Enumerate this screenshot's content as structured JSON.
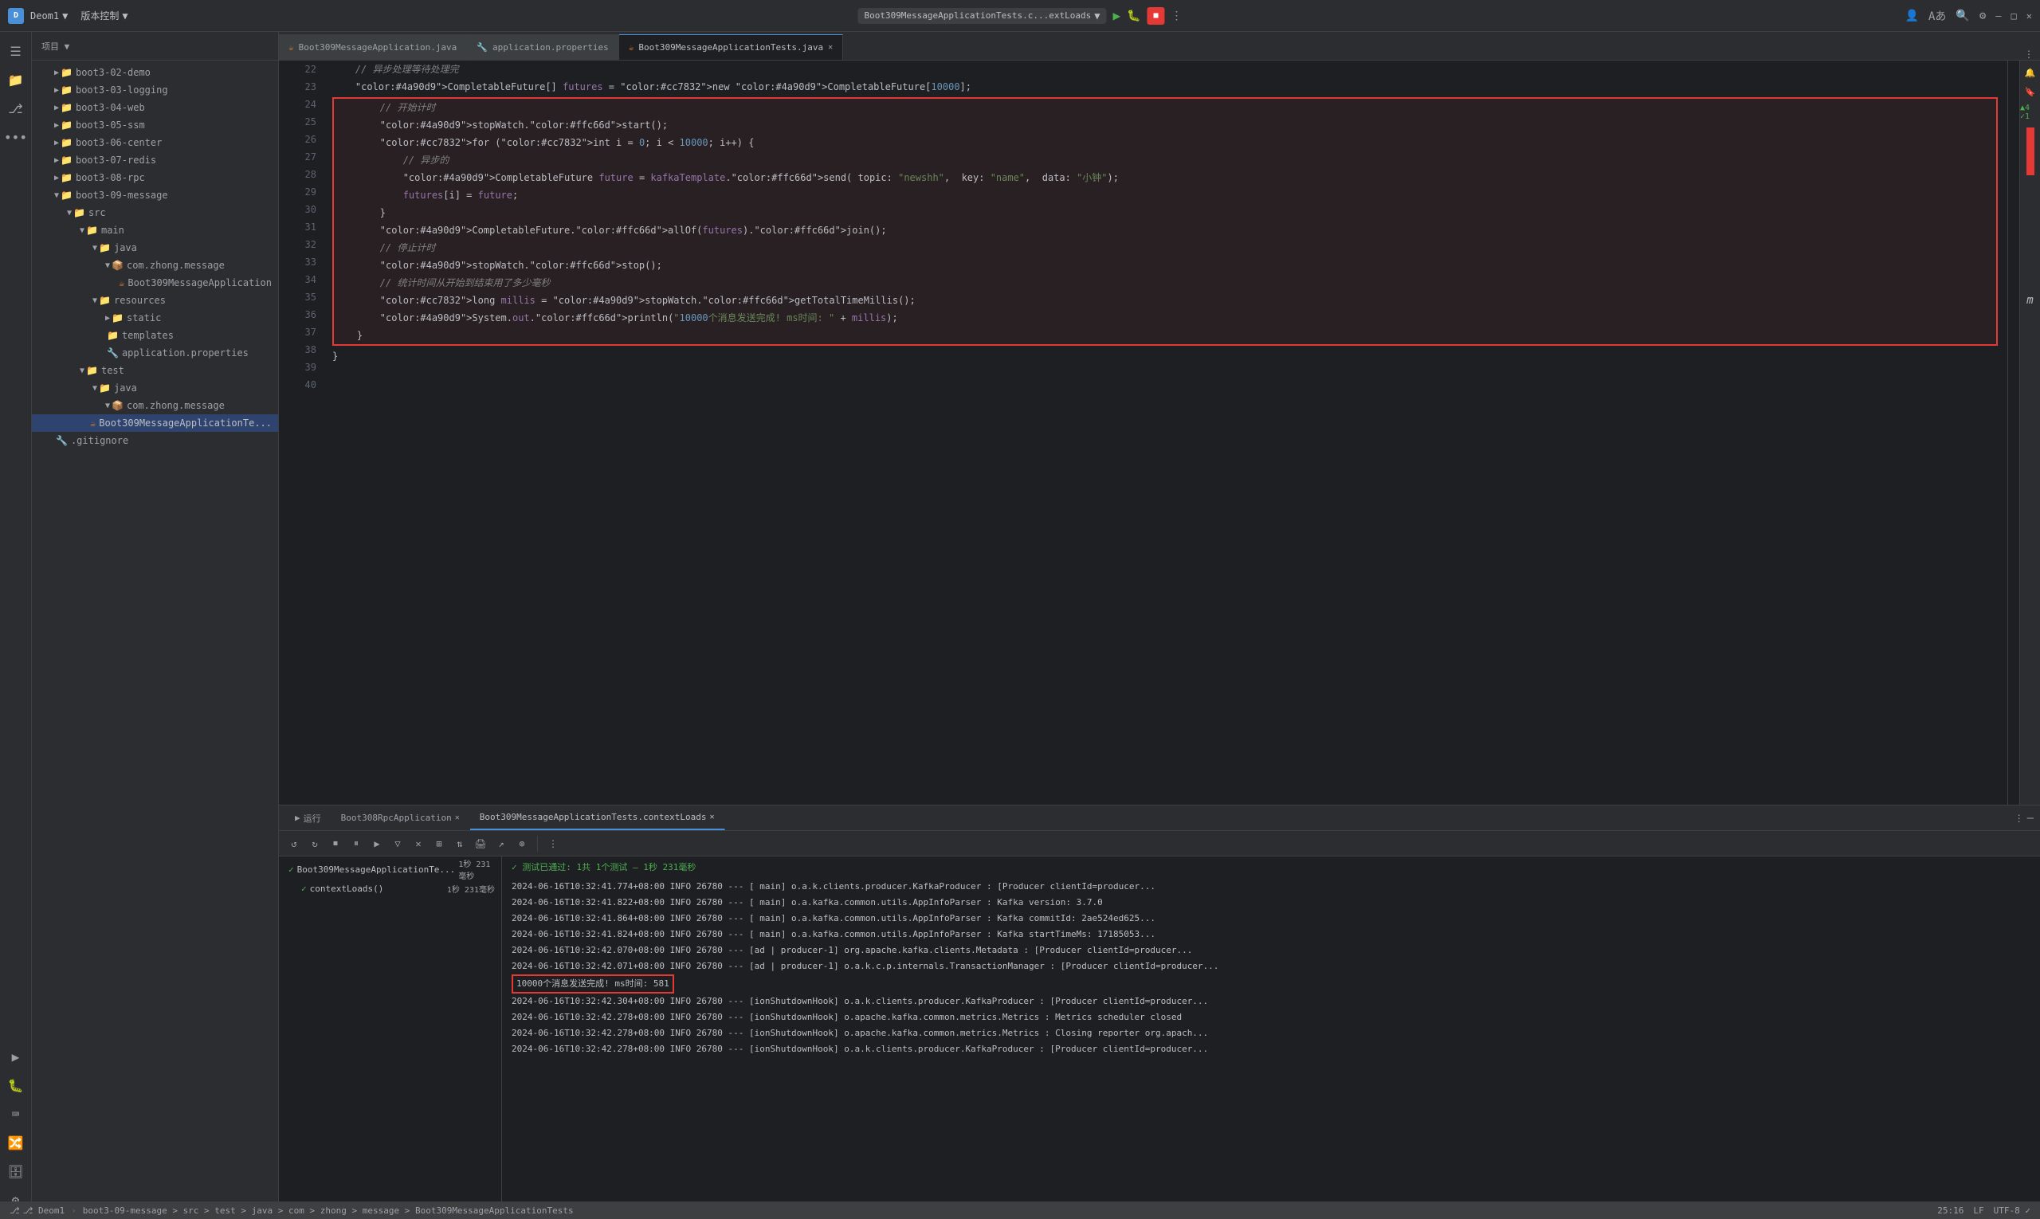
{
  "titlebar": {
    "app_icon": "D",
    "project_name": "Deom1",
    "project_arrow": "▼",
    "vcs_label": "版本控制",
    "vcs_arrow": "▼",
    "run_config": "Boot309MessageApplicationTests.c...extLoads",
    "run_config_arrow": "▼",
    "run_btn": "▶",
    "win_minimize": "—",
    "win_maximize": "□",
    "win_close": "✕"
  },
  "left_panel": {
    "header": "项目 ▼",
    "tree_items": [
      {
        "indent": 20,
        "arrow": "▶",
        "icon": "📁",
        "label": "boot3-02-demo",
        "type": "folder"
      },
      {
        "indent": 20,
        "arrow": "▶",
        "icon": "📁",
        "label": "boot3-03-logging",
        "type": "folder"
      },
      {
        "indent": 20,
        "arrow": "▶",
        "icon": "📁",
        "label": "boot3-04-web",
        "type": "folder"
      },
      {
        "indent": 20,
        "arrow": "▶",
        "icon": "📁",
        "label": "boot3-05-ssm",
        "type": "folder"
      },
      {
        "indent": 20,
        "arrow": "▶",
        "icon": "📁",
        "label": "boot3-06-center",
        "type": "folder"
      },
      {
        "indent": 20,
        "arrow": "▶",
        "icon": "📁",
        "label": "boot3-07-redis",
        "type": "folder"
      },
      {
        "indent": 20,
        "arrow": "▶",
        "icon": "📁",
        "label": "boot3-08-rpc",
        "type": "folder"
      },
      {
        "indent": 20,
        "arrow": "▼",
        "icon": "📁",
        "label": "boot3-09-message",
        "type": "folder",
        "expanded": true
      },
      {
        "indent": 36,
        "arrow": "▼",
        "icon": "📁",
        "label": "src",
        "type": "folder",
        "expanded": true
      },
      {
        "indent": 52,
        "arrow": "▼",
        "icon": "📁",
        "label": "main",
        "type": "folder",
        "expanded": true
      },
      {
        "indent": 68,
        "arrow": "▼",
        "icon": "📁",
        "label": "java",
        "type": "folder",
        "expanded": true
      },
      {
        "indent": 84,
        "arrow": "▼",
        "icon": "📦",
        "label": "com.zhong.message",
        "type": "package",
        "expanded": true
      },
      {
        "indent": 100,
        "arrow": " ",
        "icon": "☕",
        "label": "Boot309MessageApplication",
        "type": "java"
      },
      {
        "indent": 68,
        "arrow": "▼",
        "icon": "📁",
        "label": "resources",
        "type": "folder",
        "expanded": true
      },
      {
        "indent": 84,
        "arrow": "▶",
        "icon": "📁",
        "label": "static",
        "type": "folder"
      },
      {
        "indent": 84,
        "arrow": " ",
        "icon": "📁",
        "label": "templates",
        "type": "folder"
      },
      {
        "indent": 84,
        "arrow": " ",
        "icon": "🔧",
        "label": "application.properties",
        "type": "props"
      },
      {
        "indent": 52,
        "arrow": "▼",
        "icon": "📁",
        "label": "test",
        "type": "folder",
        "expanded": true
      },
      {
        "indent": 68,
        "arrow": "▼",
        "icon": "📁",
        "label": "java",
        "type": "folder",
        "expanded": true
      },
      {
        "indent": 84,
        "arrow": "▼",
        "icon": "📦",
        "label": "com.zhong.message",
        "type": "package",
        "expanded": true
      },
      {
        "indent": 100,
        "arrow": " ",
        "icon": "☕",
        "label": "Boot309MessageApplicationTe...",
        "type": "java",
        "selected": true
      },
      {
        "indent": 20,
        "arrow": " ",
        "icon": "🔧",
        "label": ".gitignore",
        "type": "git"
      }
    ]
  },
  "editor": {
    "tabs": [
      {
        "label": "Boot309MessageApplication.java",
        "icon": "☕",
        "active": false,
        "closeable": false
      },
      {
        "label": "application.properties",
        "icon": "🔧",
        "active": false,
        "closeable": false
      },
      {
        "label": "Boot309MessageApplicationTests.java",
        "icon": "☕",
        "active": true,
        "closeable": true
      }
    ],
    "lines": [
      {
        "num": 22,
        "code": "    // 异步处理等待处理完",
        "highlight": false
      },
      {
        "num": 23,
        "code": "    CompletableFuture[] futures = new CompletableFuture[10000];",
        "highlight": false
      },
      {
        "num": 24,
        "code": "",
        "highlight": false
      },
      {
        "num": 25,
        "code": "        // 开始计时",
        "highlight": true
      },
      {
        "num": 26,
        "code": "        stopWatch.start();",
        "highlight": true
      },
      {
        "num": 27,
        "code": "        for (int i = 0; i < 10000; i++) {",
        "highlight": true
      },
      {
        "num": 28,
        "code": "            // 异步的",
        "highlight": true
      },
      {
        "num": 29,
        "code": "            CompletableFuture future = kafkaTemplate.send( topic: \"newshh\",  key: \"name\",  data: \"小钟\");",
        "highlight": true
      },
      {
        "num": 30,
        "code": "            futures[i] = future;",
        "highlight": true
      },
      {
        "num": 31,
        "code": "        }",
        "highlight": true
      },
      {
        "num": 32,
        "code": "        CompletableFuture.allOf(futures).join();",
        "highlight": true
      },
      {
        "num": 33,
        "code": "        // 停止计时",
        "highlight": true
      },
      {
        "num": 34,
        "code": "        stopWatch.stop();",
        "highlight": true
      },
      {
        "num": 35,
        "code": "        // 统计时间从开始到结束用了多少毫秒",
        "highlight": true
      },
      {
        "num": 36,
        "code": "        long millis = stopWatch.getTotalTimeMillis();",
        "highlight": true
      },
      {
        "num": 37,
        "code": "        System.out.println(\"10000个消息发送完成! ms时间: \" + millis);",
        "highlight": true
      },
      {
        "num": 38,
        "code": "    }",
        "highlight": true
      },
      {
        "num": 39,
        "code": "",
        "highlight": false
      },
      {
        "num": 40,
        "code": "}",
        "highlight": false
      }
    ]
  },
  "bottom_panel": {
    "tabs": [
      {
        "label": "运行",
        "active": false,
        "icon": "▶"
      },
      {
        "label": "Boot308RpcApplication",
        "active": false,
        "closeable": true
      },
      {
        "label": "Boot309MessageApplicationTests.contextLoads",
        "active": true,
        "closeable": true
      }
    ],
    "test_items": [
      {
        "name": "Boot309MessageApplicationTe...",
        "time": "1秒 231毫秒",
        "passed": true,
        "expanded": true
      },
      {
        "name": "contextLoads()",
        "time": "1秒 231毫秒",
        "passed": true,
        "indent": true
      }
    ],
    "test_status": "✓ 测试已通过: 1共 1个测试 – 1秒 231毫秒",
    "console_lines": [
      {
        "text": "2024-06-16T10:32:41.774+08:00  INFO 26780 --- [          main] o.a.k.clients.producer.KafkaProducer    : [Producer clientId=producer...",
        "type": "info"
      },
      {
        "text": "2024-06-16T10:32:41.822+08:00  INFO 26780 --- [          main] o.a.kafka.common.utils.AppInfoParser    : Kafka version: 3.7.0",
        "type": "info"
      },
      {
        "text": "2024-06-16T10:32:41.864+08:00  INFO 26780 --- [          main] o.a.kafka.common.utils.AppInfoParser    : Kafka commitId: 2ae524ed625...",
        "type": "info"
      },
      {
        "text": "2024-06-16T10:32:41.824+08:00  INFO 26780 --- [          main] o.a.kafka.common.utils.AppInfoParser    : Kafka startTimeMs: 17185053...",
        "type": "info"
      },
      {
        "text": "2024-06-16T10:32:42.070+08:00  INFO 26780 --- [ad | producer-1] org.apache.kafka.clients.Metadata       : [Producer clientId=producer...",
        "type": "info"
      },
      {
        "text": "2024-06-16T10:32:42.071+08:00  INFO 26780 --- [ad | producer-1] o.a.k.c.p.internals.TransactionManager  : [Producer clientId=producer...",
        "type": "info"
      },
      {
        "text": "10000个消息发送完成! ms时间: 581",
        "type": "highlight"
      },
      {
        "text": "2024-06-16T10:32:42.304+08:00  INFO 26780 --- [ionShutdownHook] o.a.k.clients.producer.KafkaProducer    : [Producer clientId=producer...",
        "type": "info"
      },
      {
        "text": "2024-06-16T10:32:42.278+08:00  INFO 26780 --- [ionShutdownHook] o.apache.kafka.common.metrics.Metrics   : Metrics scheduler closed",
        "type": "info"
      },
      {
        "text": "2024-06-16T10:32:42.278+08:00  INFO 26780 --- [ionShutdownHook] o.apache.kafka.common.metrics.Metrics   : Closing reporter org.apach...",
        "type": "info"
      },
      {
        "text": "2024-06-16T10:32:42.278+08:00  INFO 26780 --- [ionShutdownHook] o.a.k.clients.producer.KafkaProducer    : [Producer clientId=producer...",
        "type": "info"
      }
    ]
  },
  "status_bar": {
    "branch": "⎇ Deom1",
    "breadcrumb": "boot3-09-message > src > test > java > com > zhong > message > Boot309MessageApplicationTests",
    "line_col": "25:16",
    "encoding": "UTF-8 ✓",
    "lf": "LF"
  }
}
